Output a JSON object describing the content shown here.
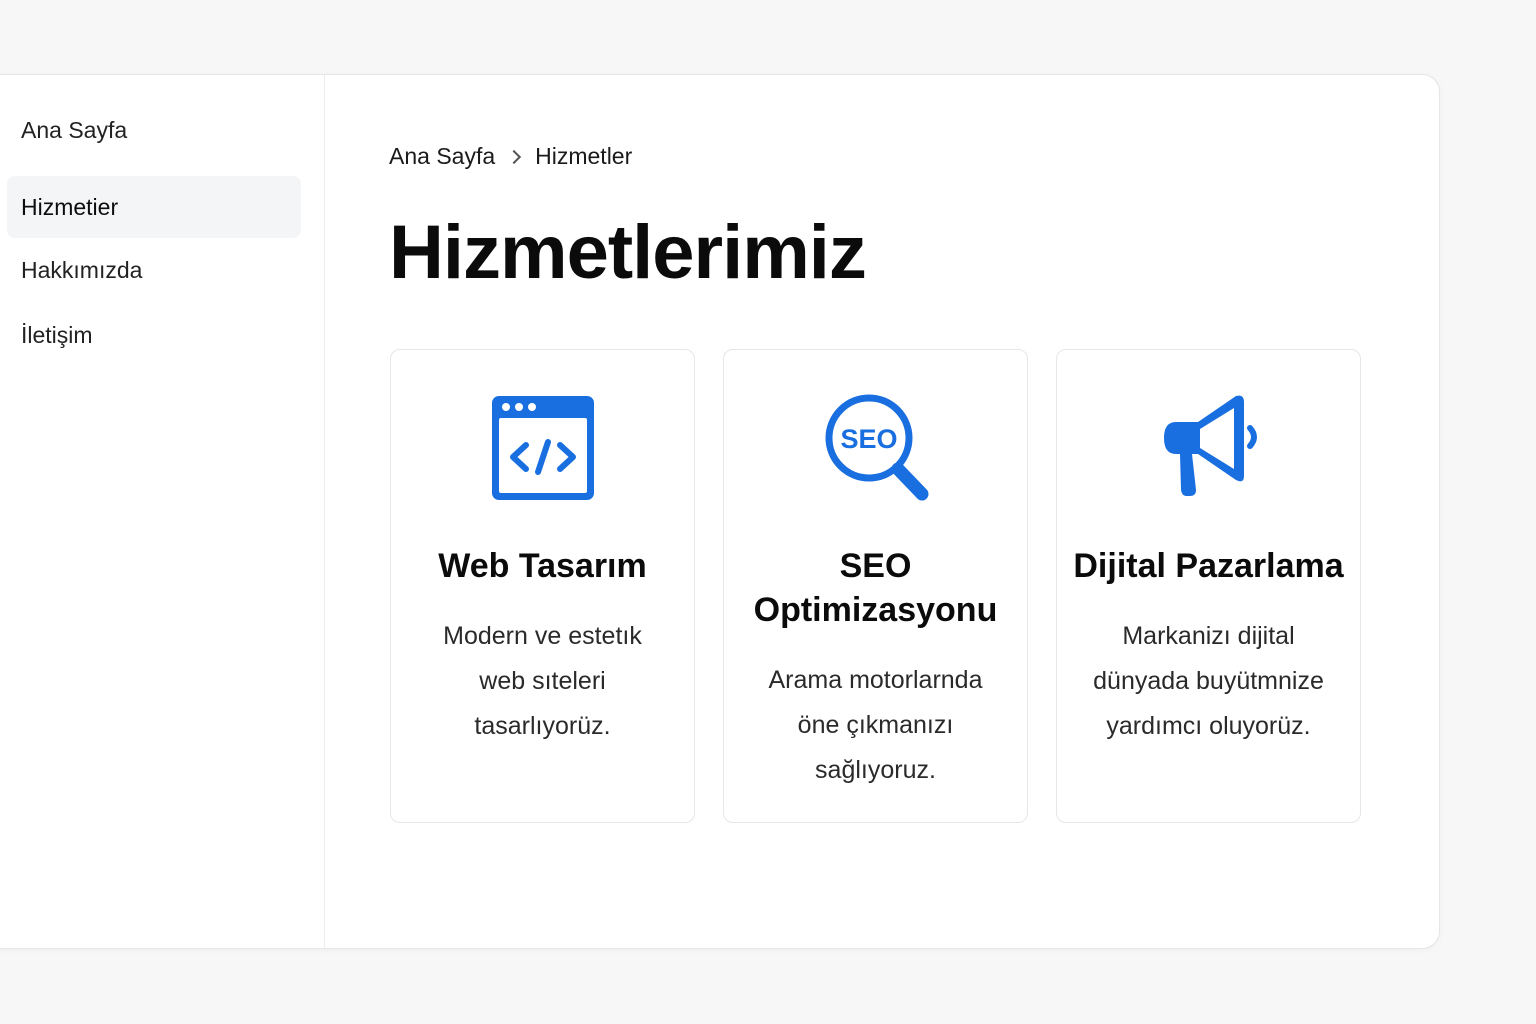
{
  "sidebar": {
    "items": [
      {
        "label": "Ana Sayfa",
        "active": false
      },
      {
        "label": "Hizmetier",
        "active": true
      },
      {
        "label": "Hakkımızda",
        "active": false
      },
      {
        "label": "İletişim",
        "active": false
      }
    ]
  },
  "breadcrumb": {
    "home": "Ana Sayfa",
    "current": "Hizmetler"
  },
  "page": {
    "title": "Hizmetlerimiz"
  },
  "cards": [
    {
      "icon": "code-window-icon",
      "title": "Web Tasarım",
      "description": "Modern ve estetık web sıteleri tasarlıyorüz."
    },
    {
      "icon": "seo-magnifier-icon",
      "title": "SEO Optimizasyonu",
      "description": "Arama motorlarnda öne çıkmanızı sağlıyoruz.",
      "icon_text": "SEO"
    },
    {
      "icon": "megaphone-icon",
      "title": "Dijital Pazarlama",
      "description": "Markanizı dijital dünyada buyütmnize yardımcı oluyorüz."
    }
  ],
  "colors": {
    "accent": "#1a6fe0",
    "active_nav_bg": "#f4f5f7",
    "border": "#e6e6e6"
  }
}
